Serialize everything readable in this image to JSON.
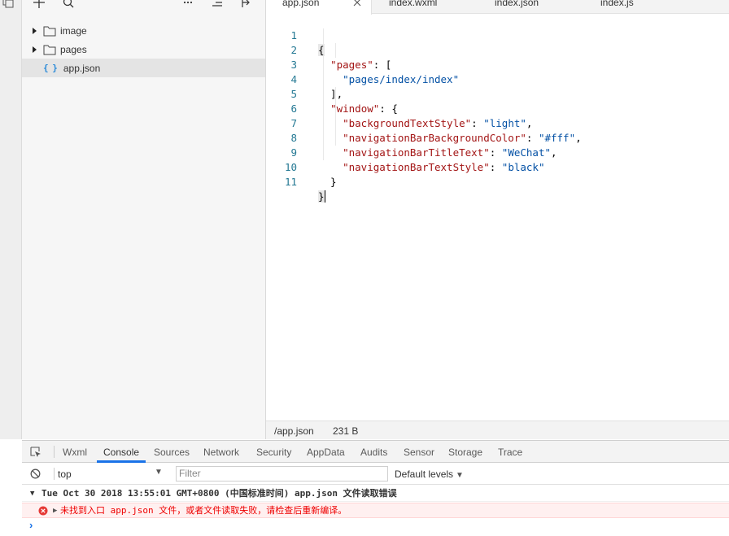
{
  "tree": {
    "items": [
      {
        "label": "image",
        "type": "folder"
      },
      {
        "label": "pages",
        "type": "folder"
      },
      {
        "label": "app.json",
        "type": "json",
        "icon_text": "{ }"
      }
    ]
  },
  "editor": {
    "tabs": [
      {
        "label": "app.json"
      },
      {
        "label": "index.wxml"
      },
      {
        "label": "index.json"
      },
      {
        "label": "index.js"
      }
    ],
    "line_numbers": [
      "1",
      "2",
      "3",
      "4",
      "5",
      "6",
      "7",
      "8",
      "9",
      "10",
      "11"
    ],
    "status": {
      "path": "/app.json",
      "size": "231 B"
    }
  },
  "devtools": {
    "tabs": [
      "Wxml",
      "Console",
      "Sources",
      "Network",
      "Security",
      "AppData",
      "Audits",
      "Sensor",
      "Storage",
      "Trace"
    ],
    "context": "top",
    "filter_placeholder": "Filter",
    "levels": "Default levels",
    "log_group": "Tue Oct 30 2018 13:55:01 GMT+0800 (中国标准时间)  app.json 文件读取错误",
    "error_message": "未找到入口 app.json 文件，或者文件读取失败，请检查后重新编译。",
    "prompt": "›"
  },
  "colors": {
    "accent": "#1a73e8",
    "error": "#e00000",
    "json_key": "#a31515",
    "json_string": "#0451a5",
    "line_number": "#237893"
  }
}
